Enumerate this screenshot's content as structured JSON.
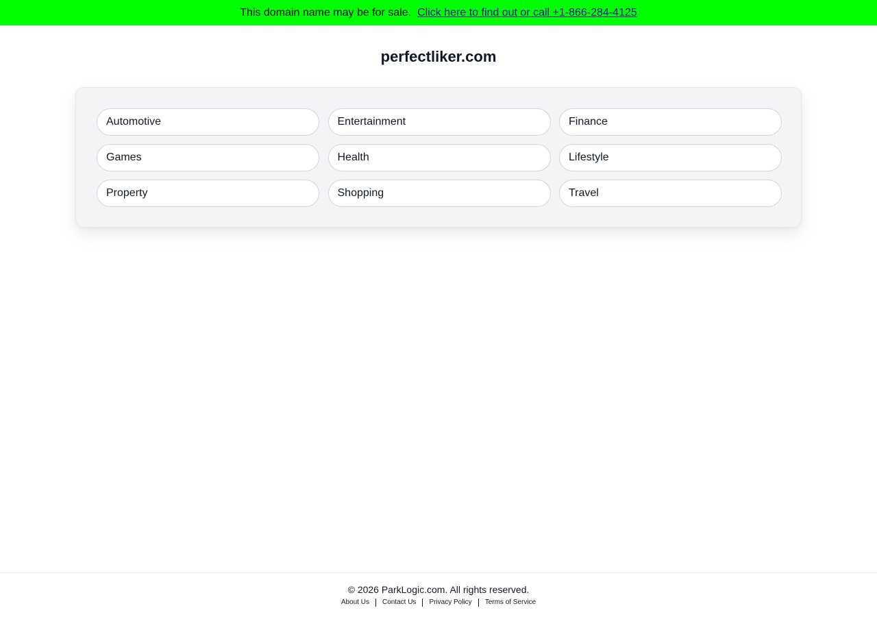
{
  "banner": {
    "text": "This domain name may be for sale.",
    "link_text": "Click here to find out or call +1-866-284-4125",
    "background": "#00ff00",
    "link_color": "#1a0dab"
  },
  "site": {
    "domain": "perfectliker.com"
  },
  "categories": [
    "Automotive",
    "Entertainment",
    "Finance",
    "Games",
    "Health",
    "Lifestyle",
    "Property",
    "Shopping",
    "Travel"
  ],
  "footer": {
    "copyright": "© 2026 ParkLogic.com. All rights reserved.",
    "links": [
      "About Us",
      "Contact Us",
      "Privacy Policy",
      "Terms of Service"
    ]
  }
}
